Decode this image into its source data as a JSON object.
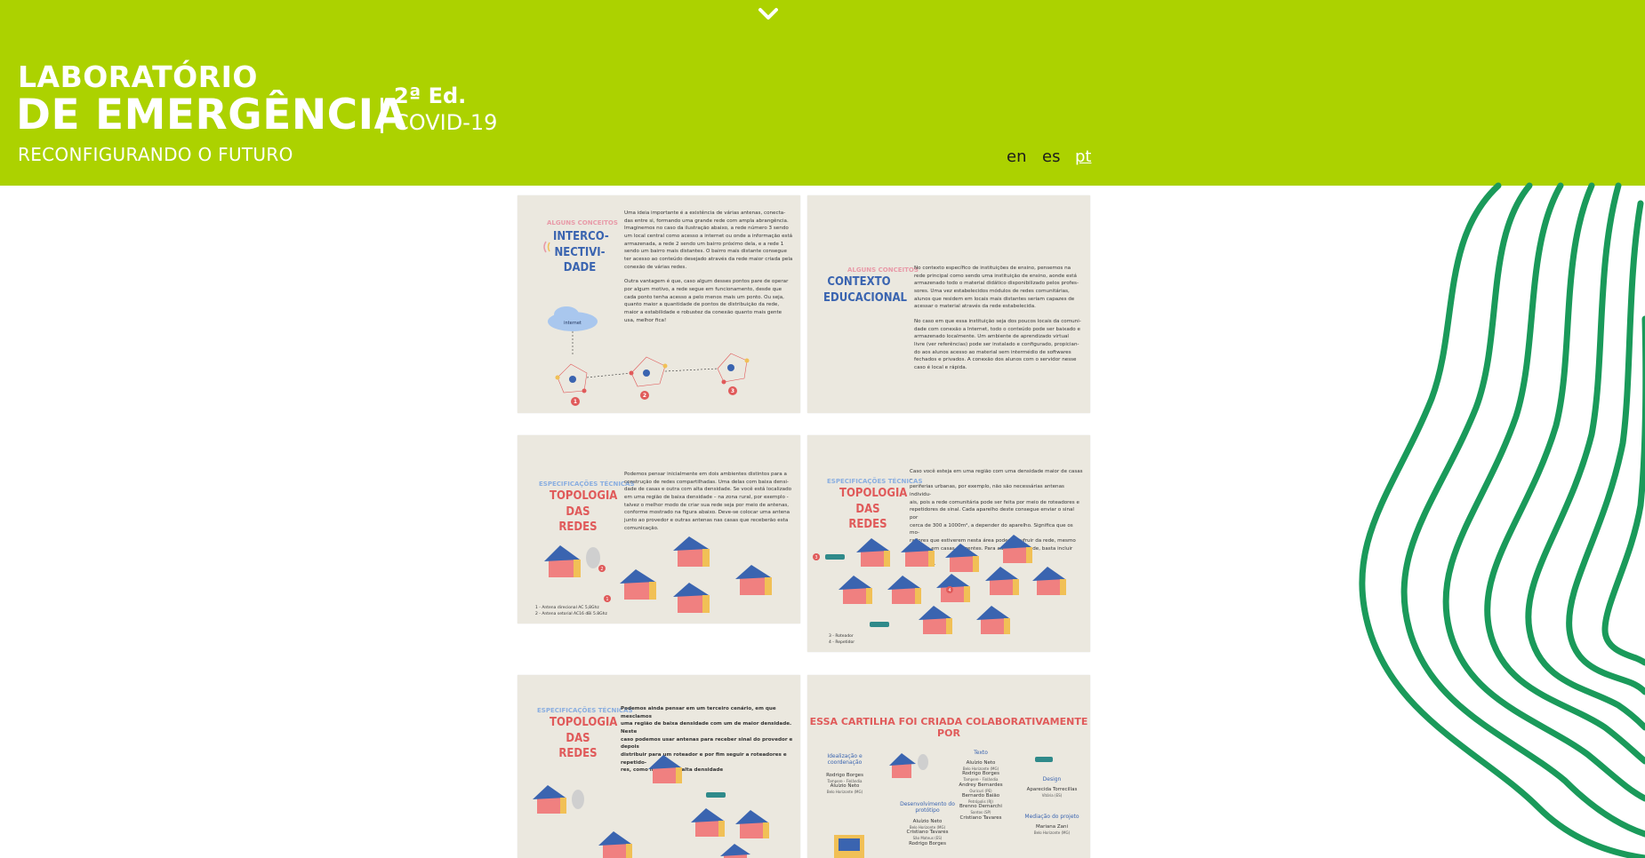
{
  "header": {
    "title_line1": "LABORATÓRIO",
    "title_line2": "DE EMERGÊNCIA",
    "edition": "2ª Ed.",
    "subject": "COVID-19",
    "tagline": "RECONFIGURANDO O FUTURO",
    "scroll_icon": "chevron-down-icon",
    "languages": [
      {
        "label": "en",
        "active": false
      },
      {
        "label": "es",
        "active": false
      },
      {
        "label": "pt",
        "active": true
      }
    ]
  },
  "colors": {
    "header_bg": "#acd200",
    "decoration": "#1a9a5a",
    "slide_bg": "#ebe8df"
  },
  "slides": [
    {
      "kicker": "ALGUNS CONCEITOS",
      "title": [
        "INTERCO-",
        "NECTIVI-",
        "DADE"
      ],
      "body": [
        "Uma ideia importante  é a existência de várias antenas, conecta-",
        "das entre si, formando uma grande rede com ampla abrangência.",
        "Imaginemos no caso da ilustração abaixo,  a rede número 3 sendo",
        "um local central como acesso a internet ou onde a informação está",
        "armazenada, a rede 2 sendo um bairro próximo dela, e a rede 1",
        "sendo um bairro mais distantes. O bairro mais distante consegue",
        "ter acesso ao conteúdo desejado através da rede maior criada pela",
        "conexão de várias redes.",
        "",
        "Outra vantagem é que, caso algum desses pontos pare de operar",
        "por algum motivo, a rede segue em funcionamento, desde que",
        "cada ponto tenha acesso a pelo menos mais um ponto. Ou seja,",
        "quanto maior a quantidade de pontos de distribuição da rede,",
        "maior a estabilidade e robustez da conexão quanto mais gente",
        "usa, melhor fica!"
      ],
      "cloud_label": "internet",
      "numbers": [
        "1",
        "2",
        "3"
      ]
    },
    {
      "kicker": "ALGUNS CONCEITOS",
      "title": [
        "CONTEXTO",
        "EDUCACIONAL"
      ],
      "body": [
        "No contexto específico de instituições de ensino, pensemos na",
        "rede principal como sendo uma instituição de ensino, aonde está",
        "armazenado todo o material didático disponibilizado pelos profes-",
        "sores. Uma vez estabelecidos módulos de redes comunitárias,",
        "alunos que residem em locais mais distantes seriam capazes de",
        "acessar o material através da rede estabelecida.",
        "",
        "No caso em que essa instituição seja dos poucos locais da comuni-",
        "dade com conexão a Internet, todo o conteúdo pode ser baixado e",
        "armazenado localmente. Um ambiente de aprendizado virtual",
        "livre (ver referências) pode ser instalado e configurado, propician-",
        "do aos alunos acesso ao material sem intermédio de softwares",
        "fechados e privados. A conexão dos alunos com o servidor nesse",
        "caso é local e rápida."
      ]
    },
    {
      "kicker": "ESPECIFICAÇÕES TÉCNICAS",
      "title": [
        "TOPOLOGIA",
        "DAS REDES"
      ],
      "body": [
        "Podemos pensar inicialmente em dois ambientes distintos para a",
        "construção de redes compartilhadas. Uma delas com baixa densi-",
        "dade de casas e outra com alta densidade. Se você está localizado",
        "em uma região de baixa densidade – na zona rural, por exemplo -",
        "talvez o melhor modo de criar sua rede seja por meio de antenas,",
        "conforme mostrado na figura abaixo. Deve-se colocar uma antena",
        "junto ao provedor e outras antenas nas casas que receberão esta",
        "comunicação."
      ],
      "legend": [
        "1 - Antena direcional AC 5,8Ghz",
        "2 - Antena setorial AC16 dBi 5.8Ghz"
      ],
      "numbers": [
        "1",
        "2"
      ]
    },
    {
      "kicker": "ESPECIFICAÇÕES TÉCNICAS",
      "title": [
        "TOPOLOGIA",
        "DAS REDES"
      ],
      "body": [
        "Caso você esteja em uma região com uma densidade maior de casas –",
        "periferias urbanas, por exemplo, não são necessárias antenas individu-",
        "ais, pois a rede comunitária pode ser feita por meio de roteadores e",
        "repetidores de sinal. Cada aparelho deste consegue enviar o sinal por",
        "cerca de 300 a 1000m², a depender do aparelho. Significa que os mo-",
        "radores que estiverem nesta área podem usufruir da rede, mesmo",
        "estando em casas diferentes. Para aumentar a rede, basta incluir novos",
        "aparelhos."
      ],
      "legend": [
        "3 - Roteador",
        "4 - Repetidor"
      ],
      "numbers": [
        "3",
        "4"
      ]
    },
    {
      "kicker": "ESPECIFICAÇÕES TÉCNICAS",
      "title": [
        "TOPOLOGIA",
        "DAS REDES"
      ],
      "body": [
        "Podemos ainda pensar em um terceiro cenário, em que mesclamos",
        "uma região de baixa densidade com um de maior densidade. Neste",
        "caso podemos usar antenas para receber sinal do provedor e depois",
        "distribuir para um roteador e por fim seguir a roteadores e repetido-",
        "res, como no caso de alta densidade"
      ]
    },
    {
      "title": "ESSA CARTILHA FOI CRIADA COLABORATIVAMENTE POR",
      "groups": [
        {
          "heading": "Idealização e coordenação",
          "people": [
            [
              "Rodrigo Borges",
              "Tampere - Finlândia"
            ],
            [
              "Aluízio Neto",
              "Belo Horizonte (MG)"
            ]
          ]
        },
        {
          "heading": "Desenvolvimento do protótipo",
          "people": [
            [
              "Aluízio Neto",
              "Belo Horizonte (MG)"
            ],
            [
              "Cristiano Tavares",
              "São Mateus (ES)"
            ],
            [
              "Rodrigo Borges",
              ""
            ]
          ]
        },
        {
          "heading": "Texto",
          "people": [
            [
              "Aluízio Neto",
              "Belo Horizonte (MG)"
            ],
            [
              "Rodrigo Borges",
              "Tampere - Finlândia"
            ],
            [
              "Andrey Bernardes",
              "Ouricuri (PE)"
            ],
            [
              "Bernardo Baião",
              "Petrópolis (RJ)"
            ],
            [
              "Brenno Demarchi",
              "Santos (SP)"
            ],
            [
              "Cristiano Tavares",
              ""
            ]
          ]
        },
        {
          "heading": "Design",
          "people": [
            [
              "Aparecida Torrecillas",
              "Vitória (ES)"
            ]
          ]
        },
        {
          "heading": "Mediação do projeto",
          "people": [
            [
              "Mariana Zani",
              "Belo Horizonte (MG)"
            ]
          ]
        }
      ]
    }
  ]
}
